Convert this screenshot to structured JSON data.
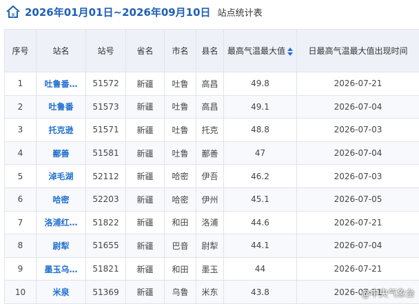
{
  "header": {
    "date_range": "2026年01月01日~2026年09月10日",
    "report_name": "站点统计表"
  },
  "table": {
    "columns": [
      "序号",
      "站名",
      "站号",
      "省名",
      "市名",
      "县名",
      "最高气温最大值",
      "日最高气温最大值出现时间"
    ],
    "rows": [
      {
        "idx": "1",
        "station": "吐鲁番…",
        "code": "51572",
        "province": "新疆",
        "city": "吐鲁",
        "county": "高昌",
        "max": "49.8",
        "date": "2026-07-21"
      },
      {
        "idx": "2",
        "station": "吐鲁番",
        "code": "51573",
        "province": "新疆",
        "city": "吐鲁",
        "county": "高昌",
        "max": "49.1",
        "date": "2026-07-04"
      },
      {
        "idx": "3",
        "station": "托克逊",
        "code": "51571",
        "province": "新疆",
        "city": "吐鲁",
        "county": "托克",
        "max": "48.8",
        "date": "2026-07-03"
      },
      {
        "idx": "4",
        "station": "鄯善",
        "code": "51581",
        "province": "新疆",
        "city": "吐鲁",
        "county": "鄯善",
        "max": "47",
        "date": "2026-07-04"
      },
      {
        "idx": "5",
        "station": "淖毛湖",
        "code": "52112",
        "province": "新疆",
        "city": "哈密",
        "county": "伊吾",
        "max": "46.2",
        "date": "2026-07-03"
      },
      {
        "idx": "6",
        "station": "哈密",
        "code": "52203",
        "province": "新疆",
        "city": "哈密",
        "county": "伊州",
        "max": "45.1",
        "date": "2026-07-05"
      },
      {
        "idx": "7",
        "station": "洛浦红…",
        "code": "51822",
        "province": "新疆",
        "city": "和田",
        "county": "洛浦",
        "max": "44.6",
        "date": "2026-07-21"
      },
      {
        "idx": "8",
        "station": "尉犁",
        "code": "51655",
        "province": "新疆",
        "city": "巴音",
        "county": "尉犁",
        "max": "44.1",
        "date": "2026-07-04"
      },
      {
        "idx": "9",
        "station": "墨玉乌…",
        "code": "51821",
        "province": "新疆",
        "city": "和田",
        "county": "墨玉",
        "max": "44",
        "date": "2026-07-21"
      },
      {
        "idx": "10",
        "station": "米泉",
        "code": "51369",
        "province": "新疆",
        "city": "乌鲁",
        "county": "米东",
        "max": "43.8",
        "date": "2026-07-21"
      }
    ]
  },
  "watermark": "@中央气象台",
  "colors": {
    "accent": "#1f5fb5",
    "header_bg": "#eef2f8",
    "link": "#1f6fd0"
  }
}
